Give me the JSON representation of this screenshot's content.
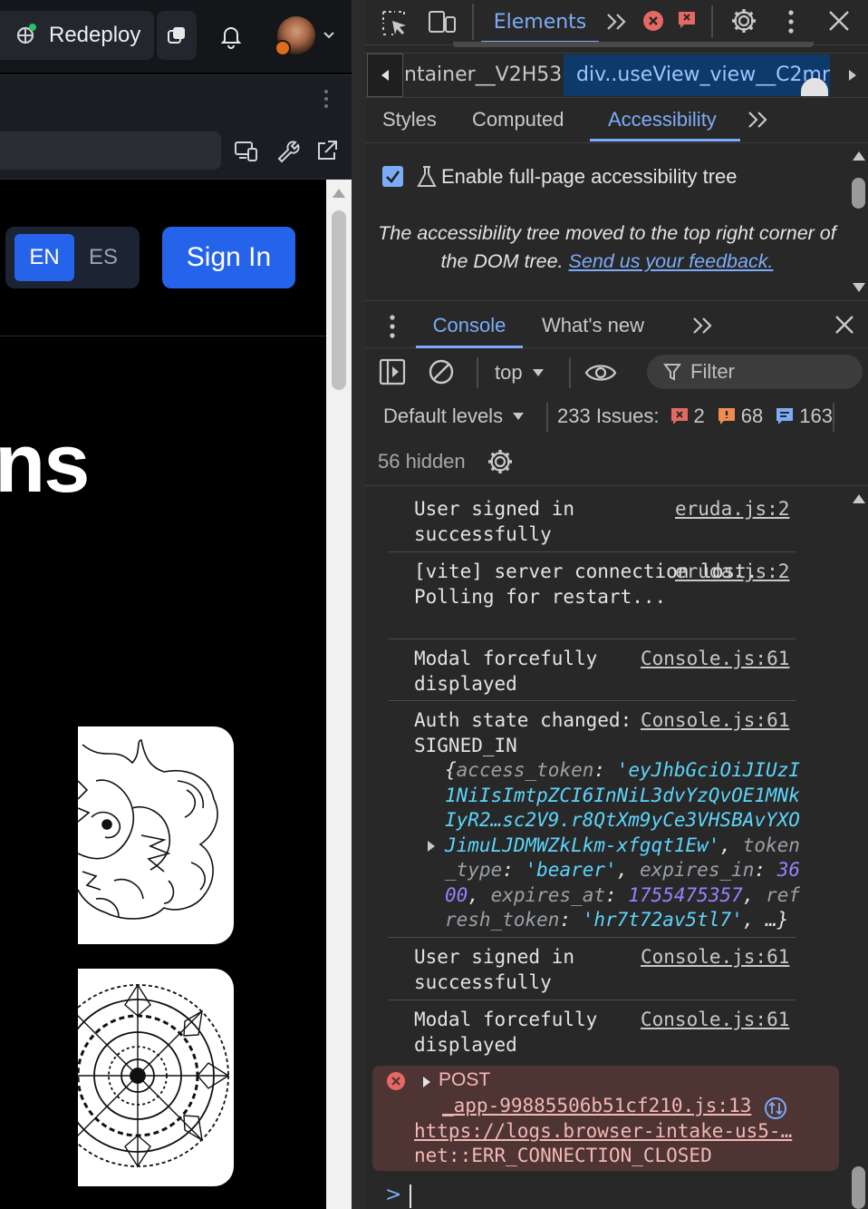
{
  "app": {
    "redeploy_label": "Redeploy",
    "lang_en": "EN",
    "lang_es": "ES",
    "sign_in_label": "Sign In",
    "hero_text": "ns"
  },
  "devtools": {
    "tabs": {
      "elements": "Elements"
    },
    "breadcrumb": {
      "item1": "ntainer__V2H53",
      "item2": "div..useView_view__C2mr..."
    },
    "subtabs": {
      "styles": "Styles",
      "computed": "Computed",
      "accessibility": "Accessibility"
    },
    "accessibility": {
      "checkbox_label": "Enable full-page accessibility tree",
      "checkbox_checked": true,
      "note_text": "The accessibility tree moved to the top right corner of the DOM tree.",
      "feedback_link": "Send us your feedback."
    },
    "drawer": {
      "console_tab": "Console",
      "whats_new_tab": "What's new"
    },
    "console_toolbar": {
      "context": "top",
      "filter_placeholder": "Filter",
      "levels": "Default levels",
      "issues_label": "233 Issues:",
      "issues_errors": "2",
      "issues_warnings": "68",
      "issues_info": "163",
      "hidden_count": "56 hidden"
    },
    "console_messages": [
      {
        "text": "User signed in successfully",
        "source": "eruda.js:2"
      },
      {
        "text": "[vite] server connection lost. Polling for restart...",
        "source": "eruda.js:2"
      },
      {
        "text": "Modal forcefully displayed",
        "source": "Console.js:61"
      },
      {
        "text": "Auth state changed: SIGNED_IN",
        "source": "Console.js:61"
      },
      {
        "text": "User signed in successfully",
        "source": "Console.js:61"
      },
      {
        "text": "Modal forcefully displayed",
        "source": "Console.js:61"
      }
    ],
    "auth_object": {
      "access_token": "'eyJhbGciOiJIUzI1NiIsImtpZCI6InNiL3dvYzQvOE1MNkIyR2…sc2V9.r8QtXm9yCe3VHSBAvYXOJimuLJDMWZkLkm-xfgqt1Ew'",
      "token_type": "'bearer'",
      "expires_in": "3600",
      "expires_at": "1755475357",
      "refresh_token": "'hr7t72av5tl7'"
    },
    "error": {
      "method": "POST",
      "source": "_app-99885506b51cf210.js:13",
      "url": "https://logs.browser-intake-us5-…",
      "message": "net::ERR_CONNECTION_CLOSED"
    },
    "prompt_symbol": ">"
  },
  "colors": {
    "accent_blue": "#2563eb",
    "devtools_accent": "#7cacf8",
    "error_bg": "#4e3534"
  }
}
